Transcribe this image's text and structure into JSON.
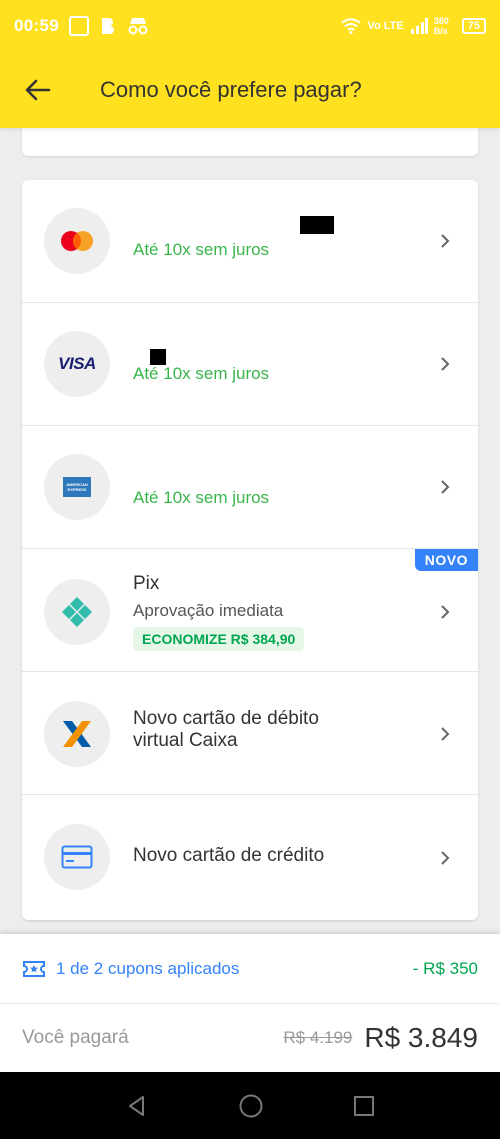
{
  "status_bar": {
    "time": "00:59",
    "network_label": "Vo LTE",
    "speed": "380 B/s",
    "battery": "75"
  },
  "header": {
    "title": "Como você prefere pagar?"
  },
  "payment_options": [
    {
      "id": "mastercard",
      "subtitle": "Até 10x sem juros"
    },
    {
      "id": "visa",
      "brand_text": "VISA",
      "subtitle": "Até 10x sem juros"
    },
    {
      "id": "amex",
      "brand_text": "AMERICAN EXPRESS",
      "subtitle": "Até 10x sem juros"
    },
    {
      "id": "pix",
      "badge": "NOVO",
      "title": "Pix",
      "subtitle": "Aprovação imediata",
      "savings": "ECONOMIZE R$ 384,90"
    },
    {
      "id": "caixa",
      "title_line1": "Novo cartão de débito",
      "title_line2": "virtual Caixa"
    },
    {
      "id": "new-credit-card",
      "title": "Novo cartão de crédito"
    }
  ],
  "coupons": {
    "label": "1 de 2 cupons aplicados",
    "discount": "- R$ 350"
  },
  "summary": {
    "label": "Você pagará",
    "old_price": "R$ 4.199",
    "new_price": "R$ 3.849"
  },
  "colors": {
    "brand_yellow": "#ffe11f",
    "link_blue": "#3483fa",
    "success_green": "#00a650",
    "installment_green": "#39b54a"
  }
}
